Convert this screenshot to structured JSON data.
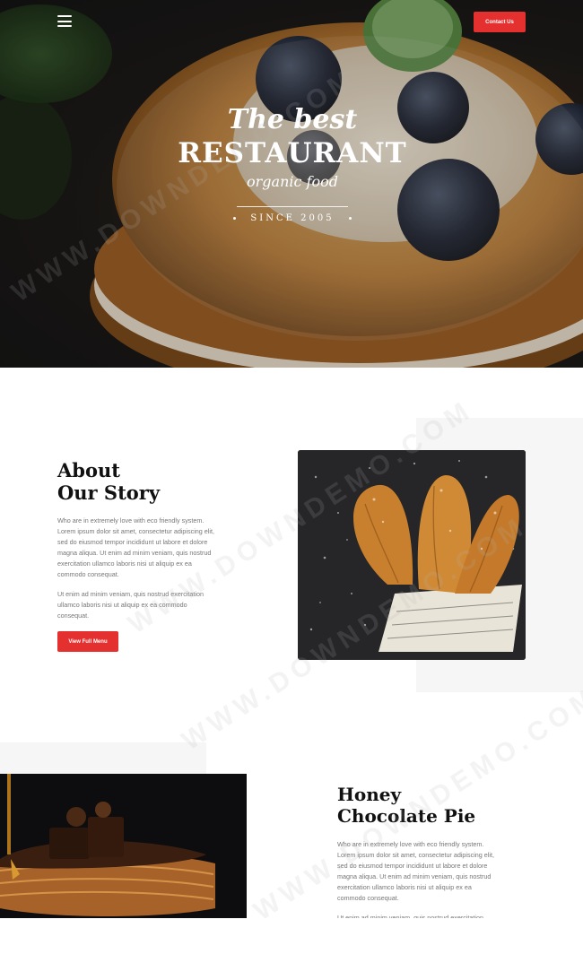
{
  "nav": {
    "menu_icon": "hamburger-menu-icon",
    "contact_label": "Contact Us"
  },
  "hero": {
    "logo_line1": "The best",
    "logo_line2": "RESTAURANT",
    "logo_line3": "organic food",
    "logo_line4": "SINCE 2005"
  },
  "about": {
    "title_line1": "About",
    "title_line2": "Our Story",
    "paragraph1": "Who are in extremely love with eco friendly system. Lorem ipsum dolor sit amet, consectetur adipiscing elit, sed do eiusmod tempor incididunt ut labore et dolore magna aliqua. Ut enim ad minim veniam, quis nostrud exercitation ullamco laboris nisi ut aliquip ex ea commodo consequat.",
    "paragraph2": "Ut enim ad minim veniam, quis nostrud exercitation ullamco laboris nisi ut aliquip ex ea commodo consequat.",
    "button_label": "View Full Menu"
  },
  "honey": {
    "title_line1": "Honey",
    "title_line2": "Chocolate Pie",
    "paragraph1": "Who are in extremely love with eco friendly system. Lorem ipsum dolor sit amet, consectetur adipiscing elit, sed do eiusmod tempor incididunt ut labore et dolore magna aliqua. Ut enim ad minim veniam, quis nostrud exercitation ullamco laboris nisi ut aliquip ex ea commodo consequat.",
    "paragraph2": "Ut enim ad minim veniam, quis nostrud exercitation"
  },
  "watermark": "WWW.DOWNDEMO.COM",
  "colors": {
    "accent": "#e53030",
    "heading": "#111111",
    "body_text": "#777777",
    "panel_gray": "#f6f6f6"
  }
}
